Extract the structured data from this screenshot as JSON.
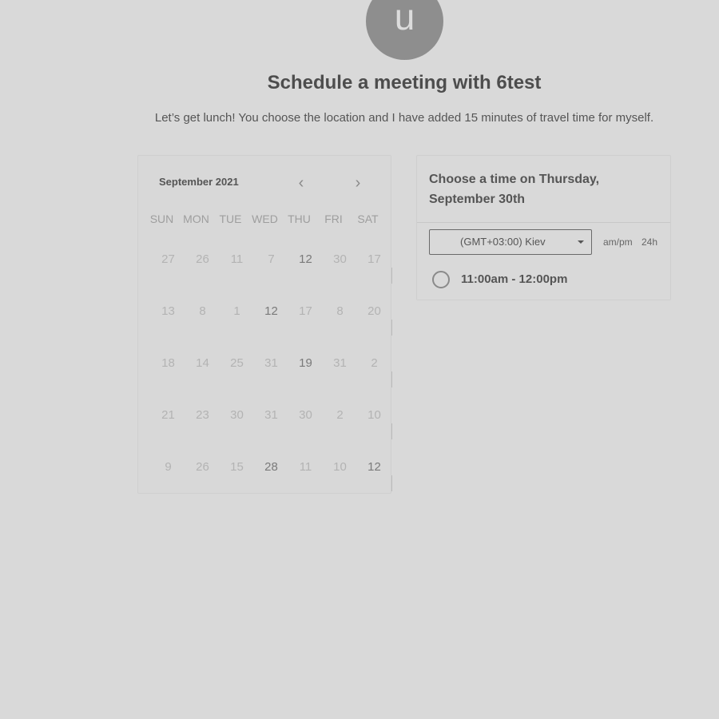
{
  "host": {
    "avatar_initial": "u",
    "title": "Schedule a meeting with 6test",
    "description": "Let’s get lunch! You choose the location and I have added 15 minutes of travel time for myself."
  },
  "calendar": {
    "month_label": "September 2021",
    "prev_glyph": "‹",
    "next_glyph": "›",
    "weekdays": [
      "SUN",
      "MON",
      "TUE",
      "WED",
      "THU",
      "FRI",
      "SAT"
    ],
    "weeks": [
      [
        {
          "d": "27",
          "a": false
        },
        {
          "d": "26",
          "a": false
        },
        {
          "d": "11",
          "a": false
        },
        {
          "d": "7",
          "a": false
        },
        {
          "d": "12",
          "a": true
        },
        {
          "d": "30",
          "a": false
        },
        {
          "d": "17",
          "a": false
        }
      ],
      [
        {
          "d": "13",
          "a": false
        },
        {
          "d": "8",
          "a": false
        },
        {
          "d": "1",
          "a": false
        },
        {
          "d": "12",
          "a": true
        },
        {
          "d": "17",
          "a": false
        },
        {
          "d": "8",
          "a": false
        },
        {
          "d": "20",
          "a": false
        }
      ],
      [
        {
          "d": "18",
          "a": false
        },
        {
          "d": "14",
          "a": false
        },
        {
          "d": "25",
          "a": false
        },
        {
          "d": "31",
          "a": false
        },
        {
          "d": "19",
          "a": true
        },
        {
          "d": "31",
          "a": false
        },
        {
          "d": "2",
          "a": false
        }
      ],
      [
        {
          "d": "21",
          "a": false
        },
        {
          "d": "23",
          "a": false
        },
        {
          "d": "30",
          "a": false
        },
        {
          "d": "31",
          "a": false
        },
        {
          "d": "30",
          "a": false
        },
        {
          "d": "2",
          "a": false
        },
        {
          "d": "10",
          "a": false
        }
      ],
      [
        {
          "d": "9",
          "a": false
        },
        {
          "d": "26",
          "a": false
        },
        {
          "d": "15",
          "a": false
        },
        {
          "d": "28",
          "a": true
        },
        {
          "d": "11",
          "a": false
        },
        {
          "d": "10",
          "a": false
        },
        {
          "d": "12",
          "a": true
        }
      ]
    ]
  },
  "times": {
    "heading": "Choose a time on Thursday, September 30th",
    "timezone_value": "(GMT+03:00) Kiev",
    "format_ampm": "am/pm",
    "format_24h": "24h",
    "slots": [
      {
        "label": "11:00am - 12:00pm"
      }
    ]
  }
}
